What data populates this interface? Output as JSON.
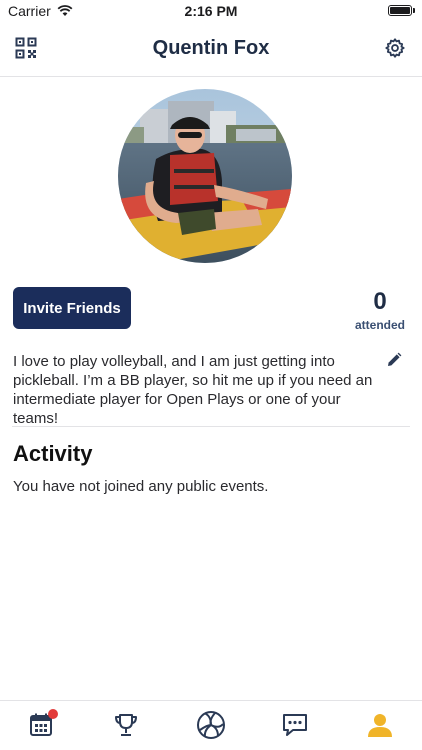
{
  "status_bar": {
    "carrier": "Carrier",
    "time": "2:16 PM"
  },
  "nav": {
    "title": "Quentin Fox"
  },
  "profile": {
    "invite_label": "Invite Friends",
    "stats": {
      "attended_count": "0",
      "attended_label": "attended"
    },
    "bio": "I love to play volleyball, and I am just getting into pickleball. I’m a BB player, so hit me up if you need an intermediate player for Open Plays or one of your teams!"
  },
  "activity": {
    "title": "Activity",
    "empty_message": "You have not joined any public events."
  },
  "tabs": [
    {
      "icon": "calendar-icon",
      "has_badge": true
    },
    {
      "icon": "trophy-icon"
    },
    {
      "icon": "volleyball-icon"
    },
    {
      "icon": "chat-icon"
    },
    {
      "icon": "profile-icon",
      "active": true
    }
  ],
  "colors": {
    "primary": "#1b2d5b",
    "title": "#1f2d45",
    "active_tab": "#f0b429",
    "badge": "#e23b3b"
  }
}
